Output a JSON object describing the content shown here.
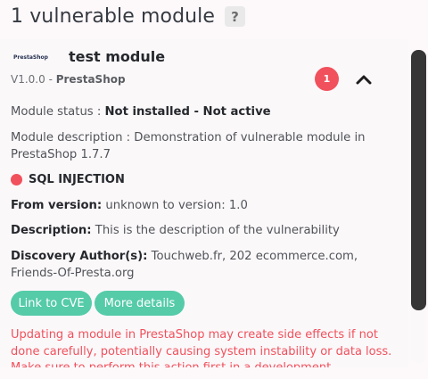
{
  "header": {
    "title": "1 vulnerable module",
    "help_glyph": "?"
  },
  "module": {
    "logo_text": "PrestaShop",
    "name": "test module",
    "version": "V1.0.0",
    "separator": " - ",
    "author": "PrestaShop",
    "vulnerability_count": "1"
  },
  "details": {
    "status_label": "Module status : ",
    "status_value": "Not installed - Not active",
    "description_label": "Module description : ",
    "description_value": "Demonstration of vulnerable module in PrestaShop 1.7.7"
  },
  "vulnerability": {
    "title": "SQL INJECTION",
    "from_version_label": "From version:",
    "from_version_value": " unknown to version: 1.0",
    "description_label": "Description:",
    "description_value": " This is the description of the vulnerability",
    "authors_label": "Discovery Author(s):",
    "authors_value": " Touchweb.fr, 202 ecommerce.com, Friends-Of-Presta.org"
  },
  "buttons": {
    "cve_label": "Link to CVE",
    "details_label": "More details"
  },
  "warning": {
    "text": "Updating a module in PrestaShop may create side effects if not done carefully, potentially causing system instability or data loss. Make sure to perform this action first in a development"
  },
  "colors": {
    "danger": "#f1515c",
    "accent_green": "#55cba8",
    "text_dark": "#25282c",
    "scrollbar": "#363636"
  }
}
